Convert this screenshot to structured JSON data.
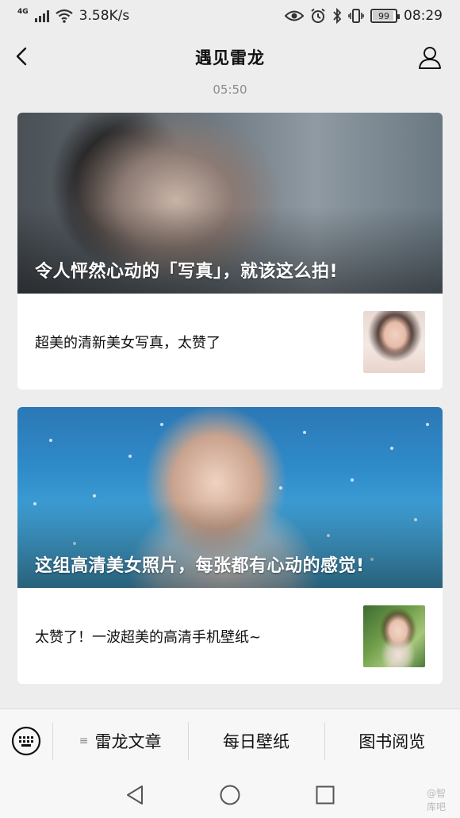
{
  "status_bar": {
    "network": "4G",
    "speed": "3.58K/s",
    "battery": "99",
    "time": "08:29"
  },
  "nav": {
    "title": "遇见雷龙"
  },
  "timestamp": "05:50",
  "articles": [
    {
      "cover_title": "令人怦然心动的「写真」，就该这么拍!",
      "sub_title": "超美的清新美女写真，太赞了"
    },
    {
      "cover_title": "这组高清美女照片，每张都有心动的感觉!",
      "sub_title": "太赞了！一波超美的高清手机壁纸~"
    }
  ],
  "bottom_menu": {
    "items": [
      "雷龙文章",
      "每日壁纸",
      "图书阅览"
    ]
  },
  "watermark": "@智库吧"
}
